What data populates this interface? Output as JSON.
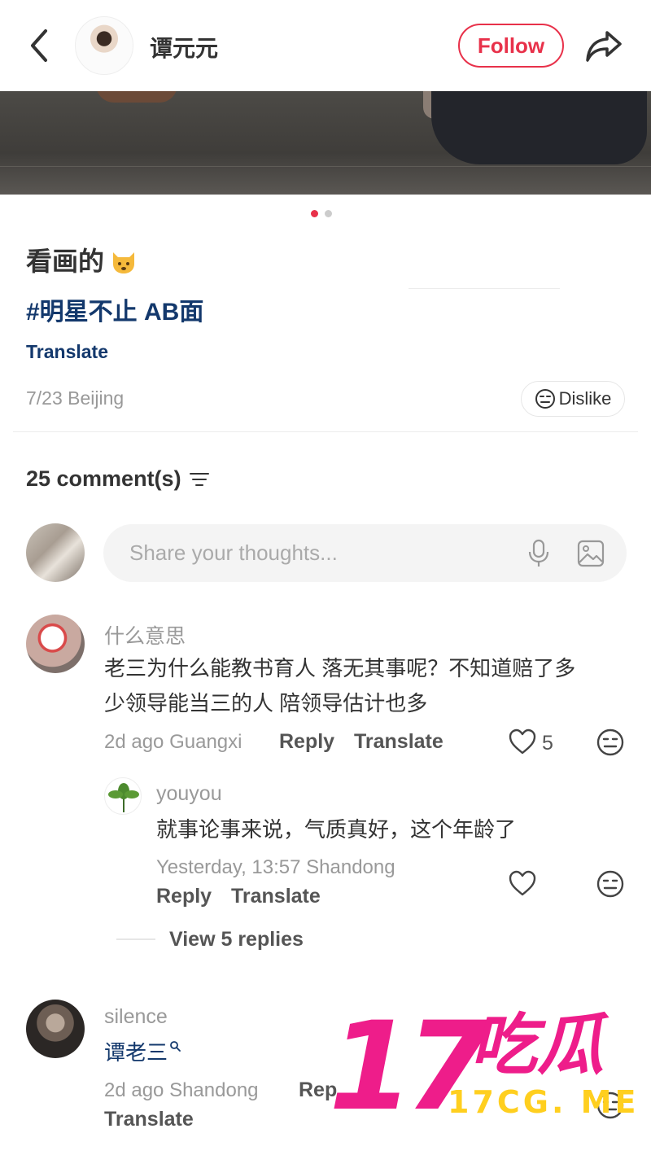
{
  "header": {
    "author_name": "谭元元",
    "follow_label": "Follow"
  },
  "post": {
    "title": "看画的",
    "title_emoji": "cat-face-emoji",
    "hashtag": "#明星不止 AB面",
    "translate_label": "Translate",
    "meta": "7/23 Beijing",
    "dislike_label": "Dislike",
    "carousel": {
      "count": 2,
      "active": 1
    }
  },
  "comments_header": {
    "count_label": "25 comment(s)"
  },
  "composer": {
    "placeholder": "Share your thoughts..."
  },
  "comments": [
    {
      "name": "什么意思",
      "text_line1": "老三为什么能教书育人 落无其事呢？不知道赔了多",
      "text_line2": "少领导能当三的人 陪领导估计也多",
      "meta": "2d ago Guangxi",
      "reply_label": "Reply",
      "translate_label": "Translate",
      "likes": "5",
      "replies": [
        {
          "name": "youyou",
          "text": "就事论事来说，气质真好，这个年龄了",
          "meta": "Yesterday, 13:57 Shandong",
          "reply_label": "Reply",
          "translate_label": "Translate"
        }
      ],
      "view_replies_label": "View 5 replies"
    },
    {
      "name": "silence",
      "text": "谭老三",
      "meta": "2d ago Shandong",
      "reply_label": "Rep",
      "translate_label": "Translate"
    }
  ],
  "watermark": {
    "number": "17",
    "chinese": "吃瓜",
    "url": "17CG. ME"
  },
  "colors": {
    "accent": "#e8314a",
    "link": "#13386c",
    "watermark_pink": "#ee1d8a",
    "watermark_yellow": "#ffcf1f"
  }
}
